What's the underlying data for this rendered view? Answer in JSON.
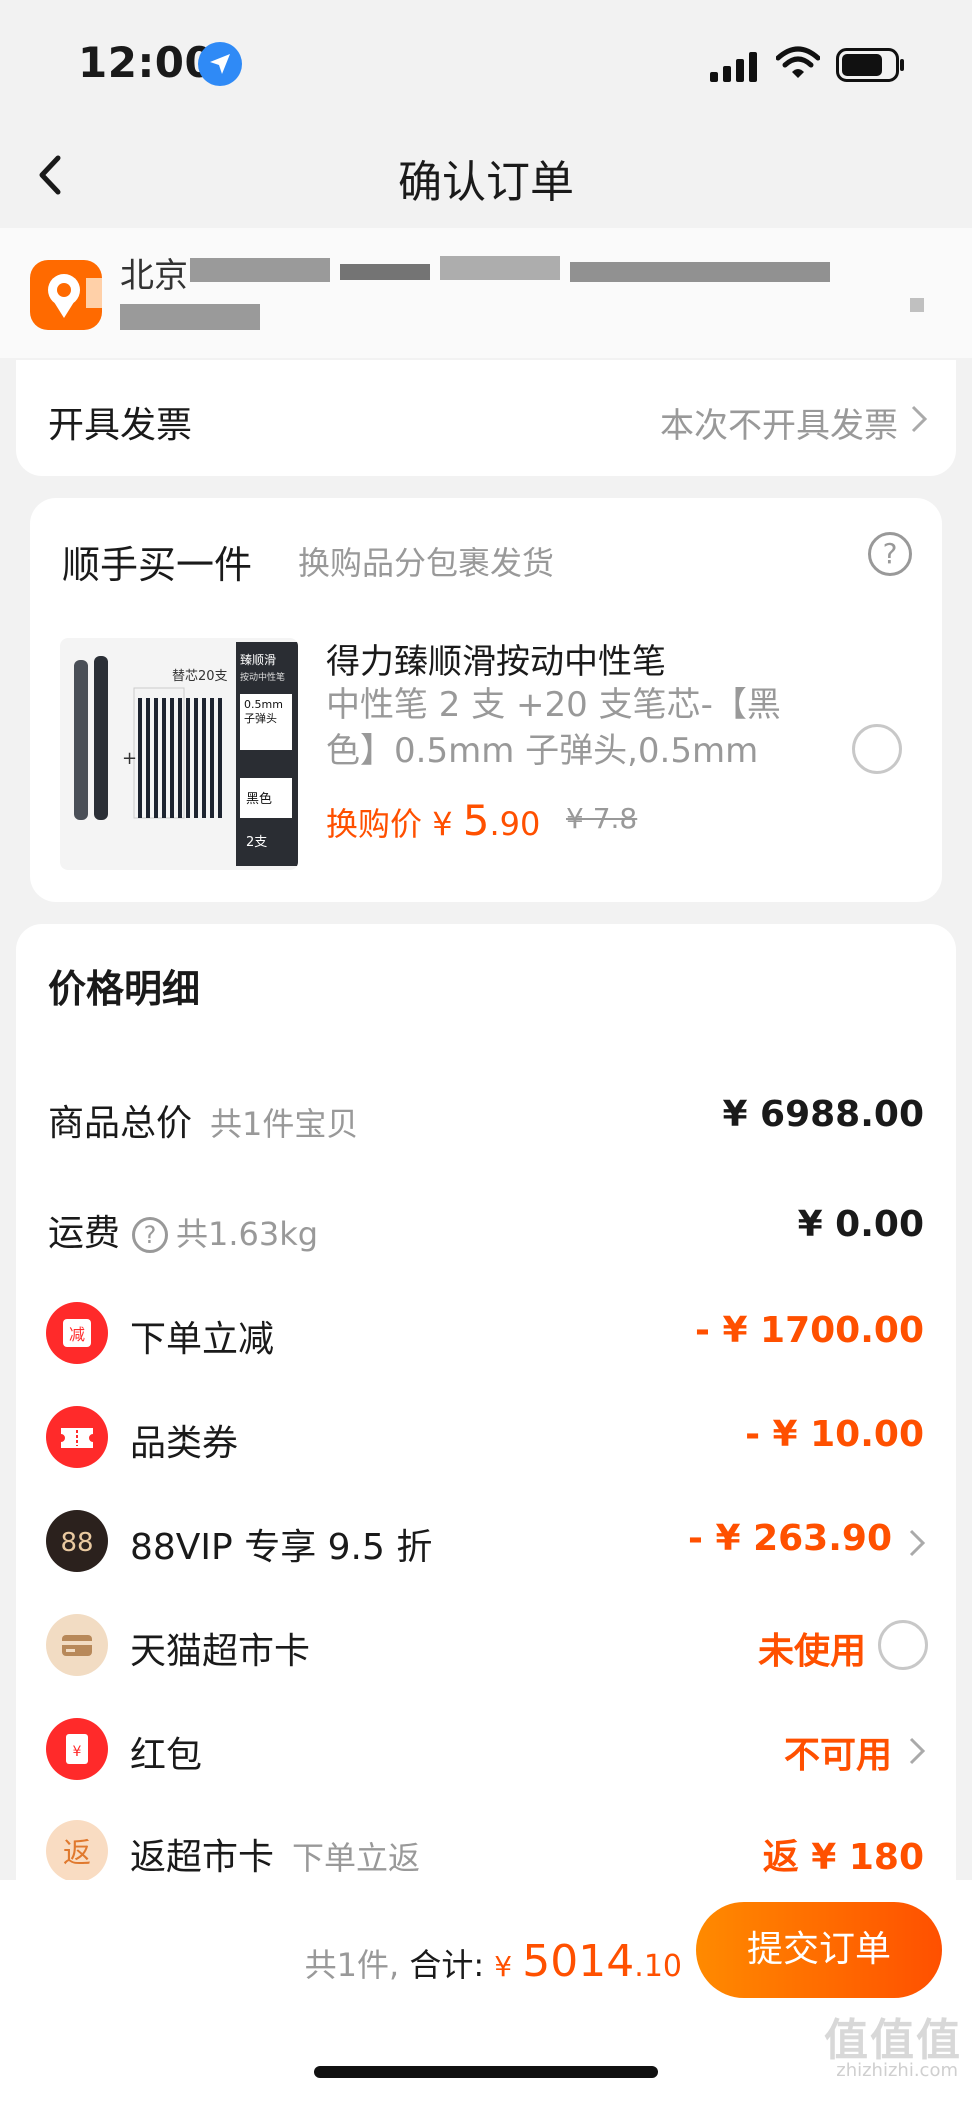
{
  "status_bar": {
    "time": "12:00"
  },
  "header": {
    "title": "确认订单"
  },
  "address": {
    "line1": "北京"
  },
  "invoice": {
    "label": "开具发票",
    "value": "本次不开具发票"
  },
  "addon": {
    "title": "顺手买一件",
    "subtitle": "换购品分包裹发货",
    "help": "?",
    "product": {
      "title": "得力臻顺滑按动中性笔",
      "desc": "中性笔 2 支 +20 支笔芯-【黑色】0.5mm 子弹头,0.5mm",
      "price_label": "换购价",
      "currency": "¥",
      "price_int": "5",
      "price_dec": ".90",
      "original_price": "¥ 7.8",
      "image_text": {
        "refill": "替芯20支",
        "brand": "臻顺滑",
        "brand_sub": "按动中性笔",
        "tip": "0.5mm",
        "tip_sub": "子弹头",
        "color": "黑色",
        "qty": "2支"
      }
    }
  },
  "price_detail": {
    "title": "价格明细",
    "rows": [
      {
        "label": "商品总价",
        "sub": "共1件宝贝",
        "value": "¥ 6988.00"
      },
      {
        "label": "运费",
        "sub": "共1.63kg",
        "value": "¥ 0.00"
      },
      {
        "label": "下单立减",
        "value": "- ¥ 1700.00",
        "icon": "减"
      },
      {
        "label": "品类券",
        "value": "- ¥ 10.00"
      },
      {
        "label": "88VIP 专享 9.5 折",
        "value": "- ¥ 263.90",
        "icon": "88"
      },
      {
        "label": "天猫超市卡",
        "value": "未使用"
      },
      {
        "label": "红包",
        "value": "不可用",
        "icon": "¥"
      },
      {
        "label": "返超市卡",
        "sub": "下单立返",
        "value": "返 ¥ 180",
        "icon": "返"
      }
    ]
  },
  "footer": {
    "count": "共1件,",
    "total_label": "合计:",
    "currency": "¥",
    "total_int": "5014",
    "total_dec": ".10",
    "submit": "提交订单"
  },
  "watermark": {
    "text": "值值值",
    "sub": "zhizhizhi.com"
  },
  "colors": {
    "accent": "#ff5000",
    "background": "#f2f2f2"
  }
}
